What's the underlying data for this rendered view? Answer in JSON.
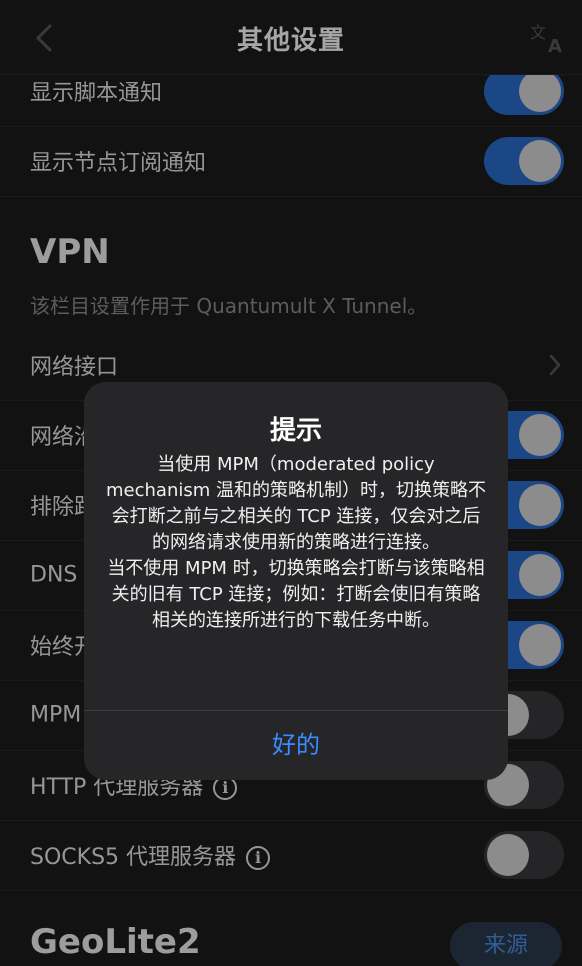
{
  "nav": {
    "title": "其他设置",
    "back_icon": "chevron-left-icon",
    "translate_icon": "translate-icon"
  },
  "rows_top": [
    {
      "label": "显示脚本通知",
      "toggle": "on"
    },
    {
      "label": "显示节点订阅通知",
      "toggle": "on"
    }
  ],
  "vpn": {
    "title": "VPN",
    "description": "该栏目设置作用于 Quantumult X Tunnel。",
    "rows": [
      {
        "label": "网络接口",
        "control": "chevron"
      },
      {
        "label": "网络沿",
        "control": "toggle",
        "toggle": "on"
      },
      {
        "label": "排除路",
        "control": "toggle",
        "toggle": "on"
      },
      {
        "label": "DNS",
        "control": "toggle",
        "toggle": "on"
      },
      {
        "label": "始终开",
        "control": "toggle",
        "toggle": "on"
      },
      {
        "label": "MPM",
        "control": "toggle",
        "toggle": "off"
      },
      {
        "label": "HTTP 代理服务器",
        "control": "toggle",
        "toggle": "off",
        "info": true
      },
      {
        "label": "SOCKS5 代理服务器",
        "control": "toggle",
        "toggle": "off",
        "info": true
      }
    ]
  },
  "geolite": {
    "title": "GeoLite2",
    "source_button": "来源"
  },
  "alert": {
    "title": "提示",
    "paragraph1": "当使用 MPM（moderated policy mechanism 温和的策略机制）时，切换策略不会打断之前与之相关的 TCP 连接，仅会对之后的网络请求使用新的策略进行连接。",
    "paragraph2": "当不使用 MPM 时，切换策略会打断与该策略相关的旧有 TCP 连接；例如：打断会使旧有策略相关的连接所进行的下载任务中断。",
    "ok_button": "好的"
  },
  "colors": {
    "accent": "#3b8cff",
    "toggle_on": "#2a6ecf",
    "background": "#1c1c1e"
  }
}
